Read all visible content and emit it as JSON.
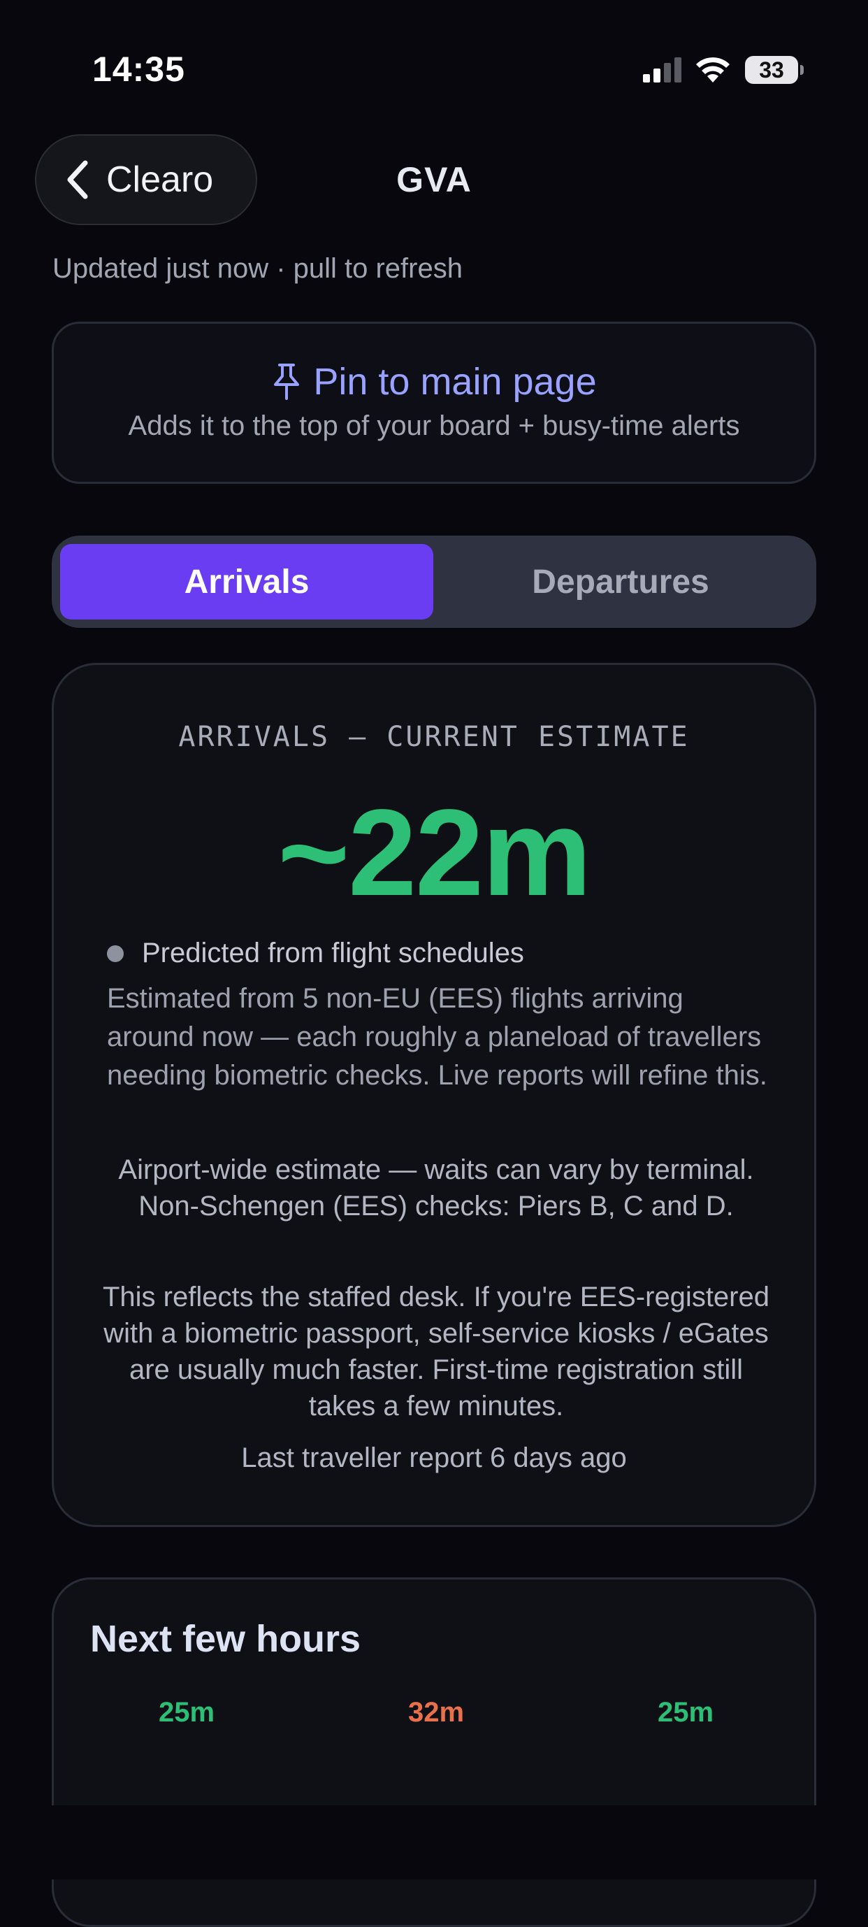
{
  "status_bar": {
    "time": "14:35",
    "battery": "33",
    "icons": [
      "signal-icon",
      "wifi-icon",
      "battery-icon"
    ]
  },
  "nav": {
    "back_label": "Clearo",
    "title": "GVA"
  },
  "updated_text": "Updated just now · pull to refresh",
  "pin_card": {
    "title": "Pin to main page",
    "subtitle": "Adds it to the top of your board + busy-time alerts",
    "icon": "pin-icon",
    "accent": "#9aa2ff"
  },
  "tabs": {
    "active": "Arrivals",
    "inactive": "Departures",
    "active_color": "#6a3df2"
  },
  "estimate": {
    "header": "ARRIVALS — CURRENT ESTIMATE",
    "value": "~22m",
    "value_color": "#2dbf76",
    "source_label": "Predicted from flight schedules",
    "source_desc": "Estimated from 5 non-EU (EES) flights arriving around now — each roughly a planeload of travellers needing biometric checks. Live reports will refine this.",
    "airport_note": "Airport-wide estimate — waits can vary by terminal. Non-Schengen (EES) checks: Piers B, C and D.",
    "staff_note": "This reflects the staffed desk. If you're EES-registered with a biometric passport, self-service kiosks / eGates are usually much faster. First-time registration still takes a few minutes.",
    "last_report": "Last traveller report 6 days ago"
  },
  "next_hours": {
    "title": "Next few hours",
    "values": [
      {
        "label": "25m",
        "color": "#2dbf76"
      },
      {
        "label": "32m",
        "color": "#e8704a"
      },
      {
        "label": "25m",
        "color": "#2dbf76"
      }
    ]
  }
}
